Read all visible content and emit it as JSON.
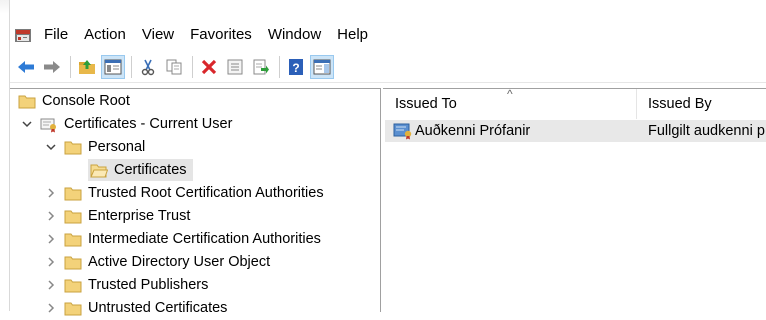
{
  "menu": [
    "File",
    "Action",
    "View",
    "Favorites",
    "Window",
    "Help"
  ],
  "toolbar": {
    "icons": [
      "back-arrow-icon",
      "forward-arrow-icon",
      "up-folder-icon",
      "show-hide-tree-icon",
      "cut-icon",
      "copy-icon",
      "delete-icon",
      "properties-icon",
      "export-list-icon",
      "help-icon",
      "show-action-pane-icon"
    ]
  },
  "tree": {
    "root": "Console Root",
    "snapin": "Certificates - Current User",
    "personal": "Personal",
    "certificates": "Certificates",
    "stores": [
      "Trusted Root Certification Authorities",
      "Enterprise Trust",
      "Intermediate Certification Authorities",
      "Active Directory User Object",
      "Trusted Publishers",
      "Untrusted Certificates"
    ]
  },
  "list": {
    "columns": [
      "Issued To",
      "Issued By"
    ],
    "sort_indicator": "^",
    "rows": [
      {
        "issued_to": "Auðkenni Prófanir",
        "issued_by": "Fullgilt audkenni p"
      }
    ]
  }
}
